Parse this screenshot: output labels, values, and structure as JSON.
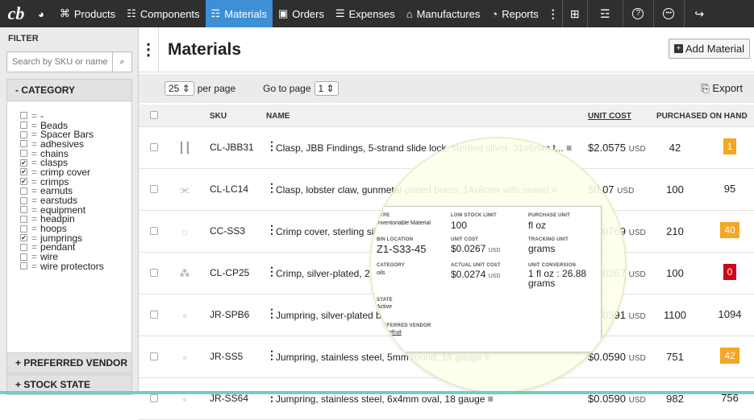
{
  "nav": {
    "logo": "cb",
    "items": [
      {
        "label": "",
        "icon": "dashboard-icon",
        "glyph": "◕"
      },
      {
        "label": "Products",
        "icon": "gift-icon",
        "glyph": "⌘"
      },
      {
        "label": "Components",
        "icon": "components-icon",
        "glyph": "☷"
      },
      {
        "label": "Materials",
        "icon": "materials-icon",
        "glyph": "☶",
        "active": true
      },
      {
        "label": "Orders",
        "icon": "bag-icon",
        "glyph": "▣"
      },
      {
        "label": "Expenses",
        "icon": "list-icon",
        "glyph": "☰"
      },
      {
        "label": "Manufactures",
        "icon": "factory-icon",
        "glyph": "⌂"
      },
      {
        "label": "Reports",
        "icon": "chart-icon",
        "glyph": "◔"
      }
    ],
    "more_glyph": "⋮",
    "right_buttons": [
      {
        "name": "expand-icon",
        "glyph": "⊞"
      },
      {
        "name": "sliders-icon",
        "glyph": "☲"
      },
      {
        "name": "help-icon",
        "glyph": "?"
      },
      {
        "name": "chat-icon",
        "glyph": "☰"
      },
      {
        "name": "logout-icon",
        "glyph": "↪"
      }
    ]
  },
  "sidebar": {
    "title": "FILTER",
    "search_placeholder": "Search by SKU or name",
    "search_icon": "⌕",
    "category_header": "-  CATEGORY",
    "categories": [
      {
        "label": "-",
        "checked": false
      },
      {
        "label": "Beads",
        "checked": false
      },
      {
        "label": "Spacer Bars",
        "checked": false
      },
      {
        "label": "adhesives",
        "checked": false
      },
      {
        "label": "chains",
        "checked": false
      },
      {
        "label": "clasps",
        "checked": true
      },
      {
        "label": "crimp cover",
        "checked": true
      },
      {
        "label": "crimps",
        "checked": true
      },
      {
        "label": "earnuts",
        "checked": false
      },
      {
        "label": "earstuds",
        "checked": false
      },
      {
        "label": "equipment",
        "checked": false
      },
      {
        "label": "headpin",
        "checked": false
      },
      {
        "label": "hoops",
        "checked": false
      },
      {
        "label": "jumprings",
        "checked": true
      },
      {
        "label": "pendant",
        "checked": false
      },
      {
        "label": "wire",
        "checked": false
      },
      {
        "label": "wire protectors",
        "checked": false
      }
    ],
    "preferred_vendor": "+  PREFERRED VENDOR",
    "stock_state": "+  STOCK STATE"
  },
  "main": {
    "title": "Materials",
    "add_button": "Add Material",
    "per_page_value": "25",
    "per_page_label": "per page",
    "goto_label": "Go to page",
    "goto_value": "1",
    "export_label": "Export",
    "columns": {
      "sku": "SKU",
      "name": "NAME",
      "unit_cost": "UNIT COST",
      "purchased": "PURCHASED",
      "on_hand": "ON HAND"
    },
    "rows": [
      {
        "sku": "CL-JBB31",
        "name": "Clasp, JBB Findings, 5-strand slide lock, sterling silver, 31x6mm t... ≡",
        "cost": "$2.0575",
        "purchased": "42",
        "on_hand": "1",
        "badge": "orange",
        "img": "┃┃"
      },
      {
        "sku": "CL-LC14",
        "name": "Clasp, lobster claw, gunmetal-plated brass, 14x8mm with swivel ≡",
        "cost": "$0.07",
        "purchased": "100",
        "on_hand": "95",
        "badge": "",
        "img": "⫘"
      },
      {
        "sku": "CC-SS3",
        "name": "Crimp cover, sterling silver",
        "cost": "$0.0769",
        "purchased": "210",
        "on_hand": "40",
        "badge": "orange",
        "img": "◌"
      },
      {
        "sku": "CL-CP25",
        "name": "Crimp, silver-plated, 2.5x2mm round, 1.5mm inside diameter",
        "cost": "$0.0267",
        "purchased": "100",
        "on_hand": "0",
        "badge": "red",
        "img": "⁂"
      },
      {
        "sku": "JR-SPB6",
        "name": "Jumpring, silver-plated brass, 6mm round, approximately 20 gauge ≡",
        "cost": "$0.0391",
        "purchased": "1100",
        "on_hand": "1094",
        "badge": "",
        "img": "◦"
      },
      {
        "sku": "JR-SS5",
        "name": "Jumpring, stainless steel, 5mm round, 18 gauge ≡",
        "cost": "$0.0590",
        "purchased": "751",
        "on_hand": "42",
        "badge": "orange",
        "img": "◦"
      },
      {
        "sku": "JR-SS64",
        "name": "Jumpring, stainless steel, 6x4mm oval, 18 gauge ≡",
        "cost": "$0.0590",
        "purchased": "982",
        "on_hand": "756",
        "badge": "",
        "img": "◦"
      }
    ],
    "usd": "USD"
  },
  "popover": {
    "type_label": "TYPE",
    "type_value": "Inventoriable Material",
    "low_stock_label": "LOW STOCK LIMIT",
    "low_stock_value": "100",
    "purchase_unit_label": "PURCHASE UNIT",
    "purchase_unit_value": "fl oz",
    "bin_label": "BIN LOCATION",
    "bin_value": "Z1-S33-45",
    "unit_cost_label": "UNIT COST",
    "unit_cost_value": "$0.0267",
    "tracking_label": "TRACKING UNIT",
    "tracking_value": "grams",
    "category_label": "CATEGORY",
    "category_value": "oils",
    "actual_cost_label": "ACTUAL UNIT COST",
    "actual_cost_value": "$0.0274",
    "conversion_label": "UNIT CONVERSION",
    "conversion_value": "1 fl oz : 26.88 grams",
    "state_label": "STATE",
    "state_value": "Active",
    "vendor_label": "PREFERRED VENDOR",
    "vendor_value": "Gracefruit",
    "usd": "USD"
  },
  "colors": {
    "nav_bg": "#2f2f2f",
    "active_tab": "#3d8fd6",
    "badge_orange": "#f5a623",
    "badge_red": "#d0021b",
    "bottom_bar": "#6ed0c0"
  }
}
